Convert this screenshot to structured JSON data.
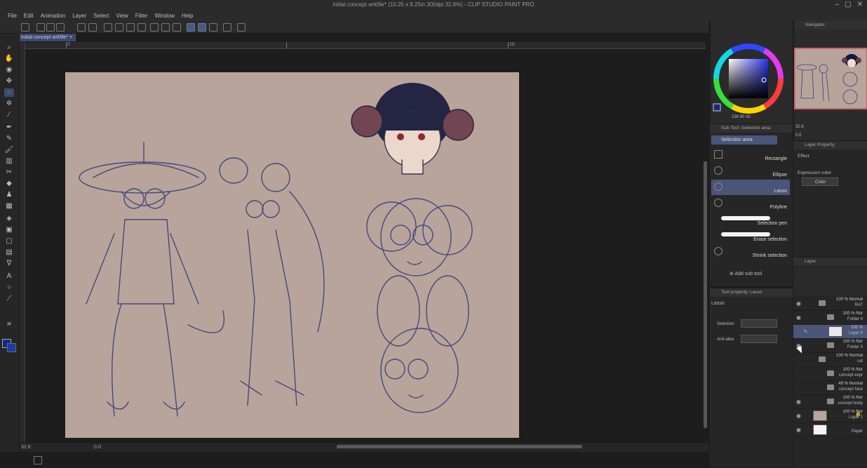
{
  "window": {
    "title": "initial concept wrkfile* (10.25 x 8.25in 300dpi 32.6%)  - CLIP STUDIO PAINT PRO"
  },
  "menu": [
    "File",
    "Edit",
    "Animation",
    "Layer",
    "Select",
    "View",
    "Filter",
    "Window",
    "Help"
  ],
  "document_tab": "initial concept wrkfile*",
  "ruler": {
    "labels": [
      "0",
      "10"
    ]
  },
  "status": {
    "zoom": "32.6",
    "rotation": "0.0"
  },
  "colors": {
    "main": "#152a80",
    "sub": "#1c3aa8",
    "canvas_bg": "#b8a49b",
    "sketch": "#3a3f7a",
    "selection_accent": "#4a5578"
  },
  "color_panel": {
    "values": "238  90  43"
  },
  "sub_tool": {
    "title": "Sub Tool: Selection area",
    "group": "Selection area",
    "items": [
      {
        "label": "Rectangle",
        "icon": "rectangle-icon",
        "selected": false
      },
      {
        "label": "Ellipse",
        "icon": "ellipse-icon",
        "selected": false
      },
      {
        "label": "Lasso",
        "icon": "lasso-icon",
        "selected": true
      },
      {
        "label": "Polyline",
        "icon": "polyline-icon",
        "selected": false
      },
      {
        "label": "Selection pen",
        "icon": "selection-pen-icon",
        "selected": false
      },
      {
        "label": "Erase selection",
        "icon": "erase-selection-icon",
        "selected": false
      },
      {
        "label": "Shrink selection",
        "icon": "shrink-selection-icon",
        "selected": false
      }
    ],
    "add_sub_tool": "Add sub tool"
  },
  "tool_property": {
    "title": "Tool property: Lasso",
    "tool_name": "Lasso",
    "selection_label": "Selection",
    "antialias_label": "Anti-alias"
  },
  "navigator": {
    "title": "Navigator",
    "zoom": "32.6",
    "rotation": "0.0"
  },
  "layer_property": {
    "title": "Layer Property",
    "effect_label": "Effect",
    "expression_color_label": "Expression color",
    "expression_color_value": "Color"
  },
  "layer_panel": {
    "title": "Layer",
    "layers": [
      {
        "line1": "100 % Normal",
        "line2": "RAT",
        "type": "folder",
        "indent": 0,
        "selected": false
      },
      {
        "line1": "100 % Nor",
        "line2": "Folder 4",
        "type": "folder",
        "indent": 1,
        "selected": false
      },
      {
        "line1": "100 %",
        "line2": "Layer 5",
        "type": "layer",
        "indent": 2,
        "selected": true
      },
      {
        "line1": "100 % Nor",
        "line2": "Folder 3",
        "type": "folder",
        "indent": 1,
        "selected": false
      },
      {
        "line1": "100 % Normal",
        "line2": "cat",
        "type": "folder",
        "indent": 0,
        "selected": false
      },
      {
        "line1": "100 % Nor",
        "line2": "concept expr",
        "type": "folder",
        "indent": 1,
        "selected": false
      },
      {
        "line1": "49 % Normal",
        "line2": "concept face",
        "type": "folder",
        "indent": 1,
        "selected": false
      },
      {
        "line1": "100 % Nor",
        "line2": "concept body",
        "type": "folder",
        "indent": 1,
        "selected": false
      },
      {
        "line1": "100 % Nor",
        "line2": "Layer 2",
        "type": "layer",
        "indent": 0,
        "selected": false
      },
      {
        "line1": "",
        "line2": "Paper",
        "type": "paper",
        "indent": 0,
        "selected": false
      }
    ]
  }
}
